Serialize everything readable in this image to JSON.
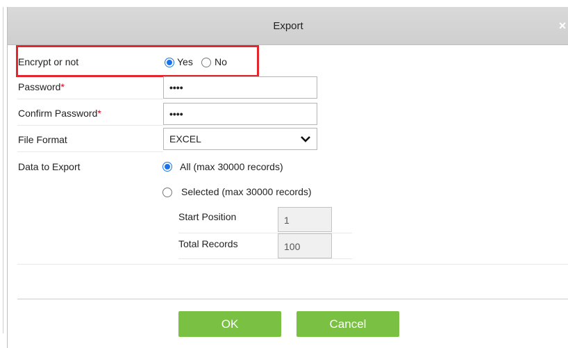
{
  "dialog": {
    "title": "Export",
    "close_glyph": "×"
  },
  "form": {
    "encrypt": {
      "label": "Encrypt or not",
      "yes_label": "Yes",
      "no_label": "No",
      "selected": "Yes"
    },
    "password": {
      "label": "Password",
      "required_mark": "*",
      "value": "••••"
    },
    "confirm_password": {
      "label": "Confirm Password",
      "required_mark": "*",
      "value": "••••"
    },
    "file_format": {
      "label": "File Format",
      "value": "EXCEL"
    },
    "data_to_export": {
      "label": "Data to Export",
      "all_label": "All (max 30000 records)",
      "selected_label": "Selected (max 30000 records)",
      "selected": "All",
      "start_position_label": "Start Position",
      "start_position_value": "1",
      "total_records_label": "Total Records",
      "total_records_value": "100"
    }
  },
  "buttons": {
    "ok_label": "OK",
    "cancel_label": "Cancel"
  },
  "colors": {
    "accent_button": "#7ac143",
    "highlight_border": "#e3262e",
    "radio_checked": "#1a73e8",
    "required": "#d0021b"
  },
  "icons": {
    "close": "close-icon",
    "dropdown": "chevron-down-icon"
  }
}
